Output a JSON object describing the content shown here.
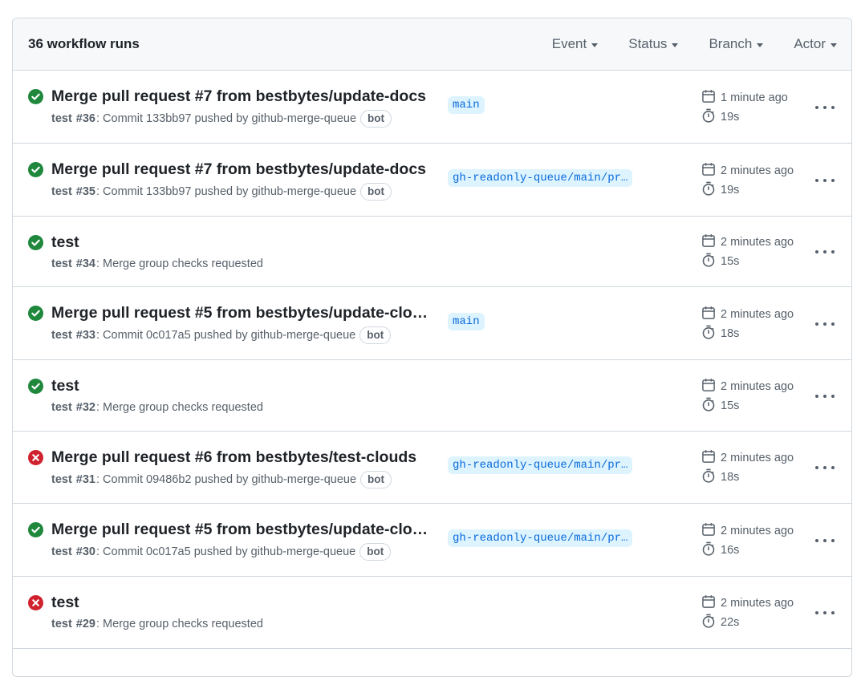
{
  "header": {
    "count_label": "36 workflow runs",
    "filters": [
      "Event",
      "Status",
      "Branch",
      "Actor"
    ]
  },
  "colors": {
    "success": "#1f883d",
    "failure": "#cf222e",
    "branch_bg": "#ddf4ff",
    "branch_fg": "#0969da"
  },
  "runs": [
    {
      "status": "success",
      "title": "Merge pull request #7 from bestbytes/update-docs",
      "workflow": "test",
      "run": "#36",
      "description": ": Commit 133bb97 pushed by github-merge-queue",
      "bot": "bot",
      "branch": "main",
      "time": "1 minute ago",
      "duration": "19s",
      "status_icon": "check-circle-icon"
    },
    {
      "status": "success",
      "title": "Merge pull request #7 from bestbytes/update-docs",
      "workflow": "test",
      "run": "#35",
      "description": ": Commit 133bb97 pushed by github-merge-queue",
      "bot": "bot",
      "branch": "gh-readonly-queue/main/pr…",
      "time": "2 minutes ago",
      "duration": "19s",
      "status_icon": "check-circle-icon"
    },
    {
      "status": "success",
      "title": "test",
      "workflow": "test",
      "run": "#34",
      "description": ": Merge group checks requested",
      "bot": null,
      "branch": null,
      "time": "2 minutes ago",
      "duration": "15s",
      "status_icon": "check-circle-icon"
    },
    {
      "status": "success",
      "title": "Merge pull request #5 from bestbytes/update-clo…",
      "workflow": "test",
      "run": "#33",
      "description": ": Commit 0c017a5 pushed by github-merge-queue",
      "bot": "bot",
      "branch": "main",
      "time": "2 minutes ago",
      "duration": "18s",
      "status_icon": "check-circle-icon"
    },
    {
      "status": "success",
      "title": "test",
      "workflow": "test",
      "run": "#32",
      "description": ": Merge group checks requested",
      "bot": null,
      "branch": null,
      "time": "2 minutes ago",
      "duration": "15s",
      "status_icon": "check-circle-icon"
    },
    {
      "status": "failure",
      "title": "Merge pull request #6 from bestbytes/test-clouds",
      "workflow": "test",
      "run": "#31",
      "description": ": Commit 09486b2 pushed by github-merge-queue",
      "bot": "bot",
      "branch": "gh-readonly-queue/main/pr…",
      "time": "2 minutes ago",
      "duration": "18s",
      "status_icon": "x-circle-icon"
    },
    {
      "status": "success",
      "title": "Merge pull request #5 from bestbytes/update-clo…",
      "workflow": "test",
      "run": "#30",
      "description": ": Commit 0c017a5 pushed by github-merge-queue",
      "bot": "bot",
      "branch": "gh-readonly-queue/main/pr…",
      "time": "2 minutes ago",
      "duration": "16s",
      "status_icon": "check-circle-icon"
    },
    {
      "status": "failure",
      "title": "test",
      "workflow": "test",
      "run": "#29",
      "description": ": Merge group checks requested",
      "bot": null,
      "branch": null,
      "time": "2 minutes ago",
      "duration": "22s",
      "status_icon": "x-circle-icon"
    }
  ]
}
